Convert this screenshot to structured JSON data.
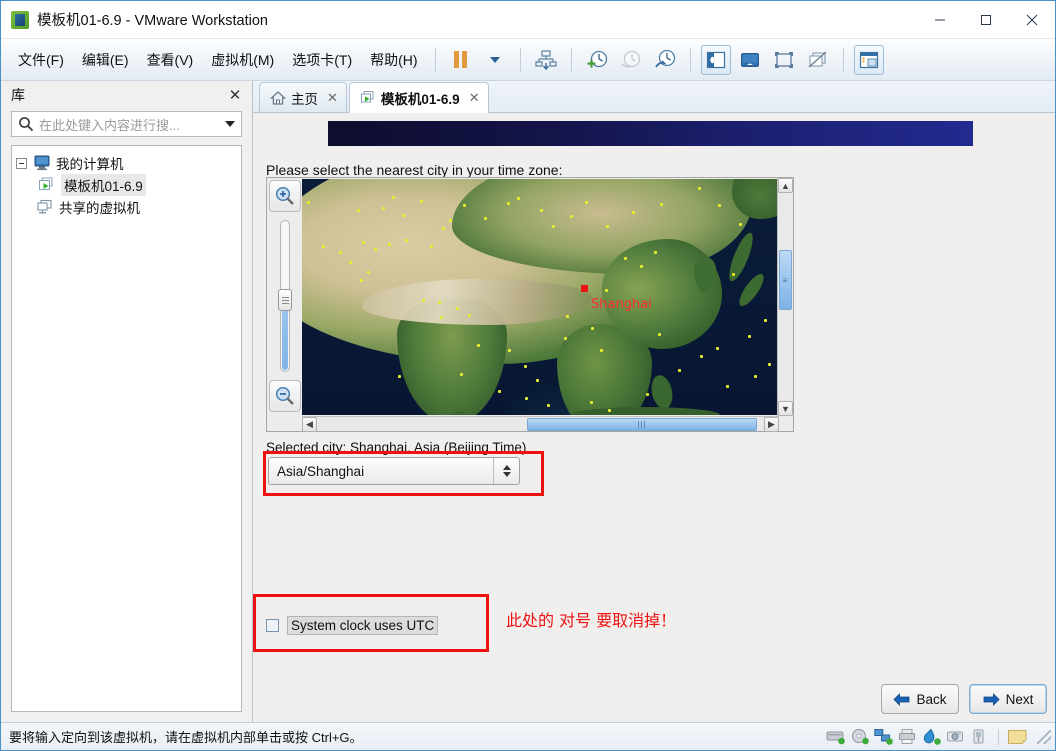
{
  "window": {
    "title": "模板机01-6.9 - VMware Workstation",
    "icon": "vmware-logo-icon",
    "controls": {
      "minimize": "minimize-icon",
      "maximize": "maximize-icon",
      "close": "close-icon"
    }
  },
  "menubar": {
    "items": [
      {
        "text": "文件(F)",
        "plain": "文件",
        "mn": "F"
      },
      {
        "text": "编辑(E)",
        "plain": "编辑",
        "mn": "E"
      },
      {
        "text": "查看(V)",
        "plain": "查看",
        "mn": "V"
      },
      {
        "text": "虚拟机(M)",
        "plain": "虚拟机",
        "mn": "M"
      },
      {
        "text": "选项卡(T)",
        "plain": "选项卡",
        "mn": "T"
      },
      {
        "text": "帮助(H)",
        "plain": "帮助",
        "mn": "H"
      }
    ],
    "toolbar_icons": [
      "pause-icon",
      "dropdown-caret-icon",
      "snapshot-manager-icon",
      "take-snapshot-icon",
      "revert-snapshot-icon",
      "manage-snapshots-icon",
      "show-library-icon",
      "show-thumbnails-icon",
      "fullscreen-icon",
      "unity-mode-icon",
      "console-view-icon"
    ]
  },
  "sidebar": {
    "title": "库",
    "close_icon": "close-icon",
    "search": {
      "placeholder": "在此处键入内容进行搜...",
      "icon": "search-icon",
      "caret": "chevron-down-icon"
    },
    "tree": [
      {
        "label": "我的计算机",
        "icon": "my-computer-icon",
        "level": 0,
        "expanded": true,
        "selected": false
      },
      {
        "label": "模板机01-6.9",
        "icon": "virtual-machine-icon",
        "level": 1,
        "expanded": false,
        "selected": true
      },
      {
        "label": "共享的虚拟机",
        "icon": "shared-vms-icon",
        "level": 0,
        "expanded": false,
        "selected": false
      }
    ]
  },
  "tabs": [
    {
      "label": "主页",
      "icon": "home-icon",
      "close_icon": "close-icon",
      "active": false
    },
    {
      "label": "模板机01-6.9",
      "icon": "virtual-machine-icon",
      "close_icon": "close-icon",
      "active": true
    }
  ],
  "guest": {
    "prompt": "Please select the nearest city in your time zone:",
    "map": {
      "zoom_in_icon": "zoom-in-magnifier-icon",
      "zoom_out_icon": "zoom-out-magnifier-icon",
      "selected_city_marker": "Shanghai",
      "vscroll": {
        "up_icon": "chevron-up-icon",
        "down_icon": "chevron-down-icon"
      },
      "hscroll": {
        "left_icon": "chevron-left-icon",
        "right_icon": "chevron-right-icon",
        "grip": "|||"
      }
    },
    "selected_city_text": "Selected city: Shanghai, Asia (Beijing Time)",
    "timezone_value": "Asia/Shanghai",
    "utc_checkbox": {
      "label": "System clock uses UTC",
      "checked": false
    },
    "annotation": "此处的 对号 要取消掉！",
    "buttons": {
      "back": "Back",
      "next": "Next"
    }
  },
  "statusbar": {
    "text": "要将输入定向到该虚拟机，请在虚拟机内部单击或按 Ctrl+G。",
    "device_icons": [
      "hard-disk-icon",
      "cd-dvd-icon",
      "network-adapter-icon",
      "printer-icon",
      "sound-card-icon",
      "camera-icon",
      "usb-icon",
      "sticky-note-icon"
    ],
    "resize_grip": "resize-grip-icon"
  },
  "colors": {
    "accent": "#2a5f96",
    "annotation_red": "#ee1111",
    "banner_navy": "#232a8f",
    "scroll_thumb_blue": "#7cb2e6"
  }
}
